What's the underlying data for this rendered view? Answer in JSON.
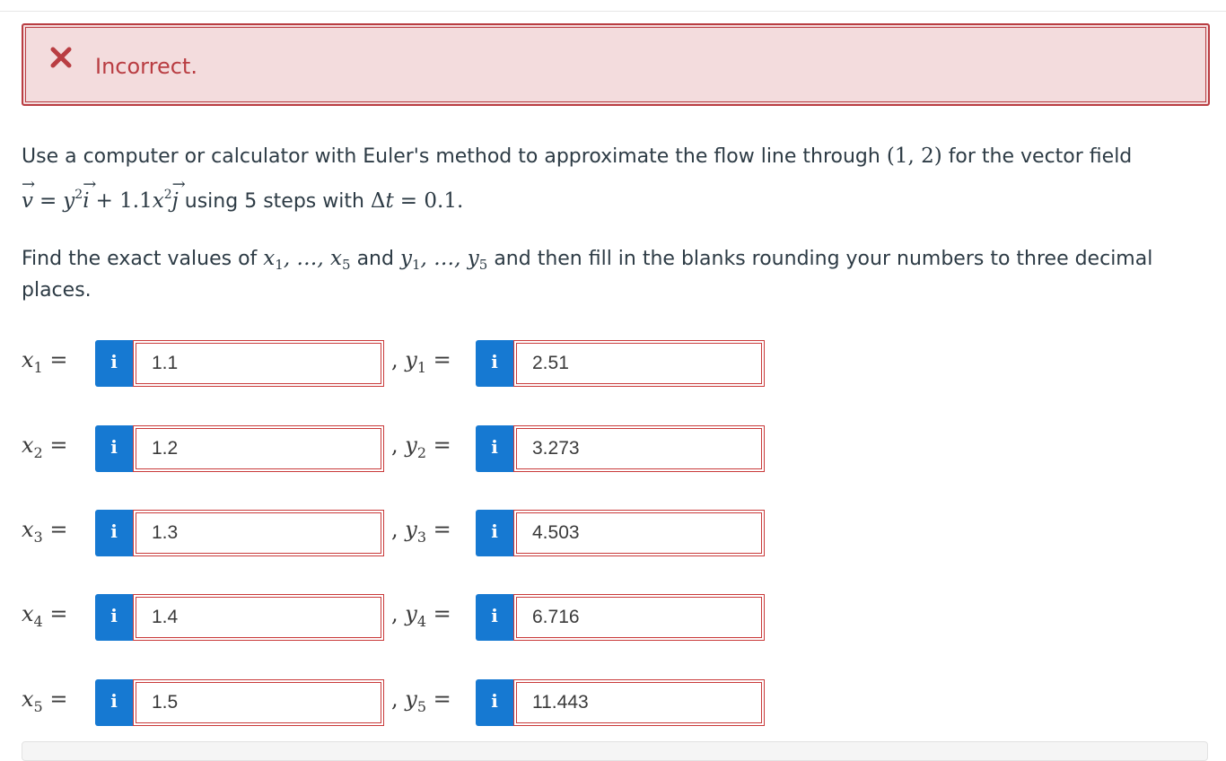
{
  "alert": {
    "text": "Incorrect.",
    "icon": "close-icon",
    "color": "#b93d42"
  },
  "problem": {
    "line1_text": "Use a computer or calculator with Euler's method to approximate the flow line through",
    "point": "(1, 2)",
    "line1_tail": "for the vector field",
    "equation_parts": {
      "v": "v",
      "eq": "=",
      "y2": "y",
      "exp1": "2",
      "i": "i",
      "plus": "+ 1.1",
      "x2": "x",
      "exp2": "2",
      "j": "j"
    },
    "line2_text": "using 5 steps with",
    "delta": "Δ",
    "t": "t",
    "delta_val": "= 0.1.",
    "find_intro": "Find the exact values of",
    "x_seq": "x",
    "and": "and",
    "find_tail": "and then fill in the blanks rounding your numbers to three decimal",
    "find_tail2": "places."
  },
  "rows": [
    {
      "x_sub": "1",
      "x_value": "1.1",
      "y_sub": "1",
      "y_value": "2.51"
    },
    {
      "x_sub": "2",
      "x_value": "1.2",
      "y_sub": "2",
      "y_value": "3.273"
    },
    {
      "x_sub": "3",
      "x_value": "1.3",
      "y_sub": "3",
      "y_value": "4.503"
    },
    {
      "x_sub": "4",
      "x_value": "1.4",
      "y_sub": "4",
      "y_value": "6.716"
    },
    {
      "x_sub": "5",
      "x_value": "1.5",
      "y_sub": "5",
      "y_value": "11.443"
    }
  ],
  "info_label": "i"
}
